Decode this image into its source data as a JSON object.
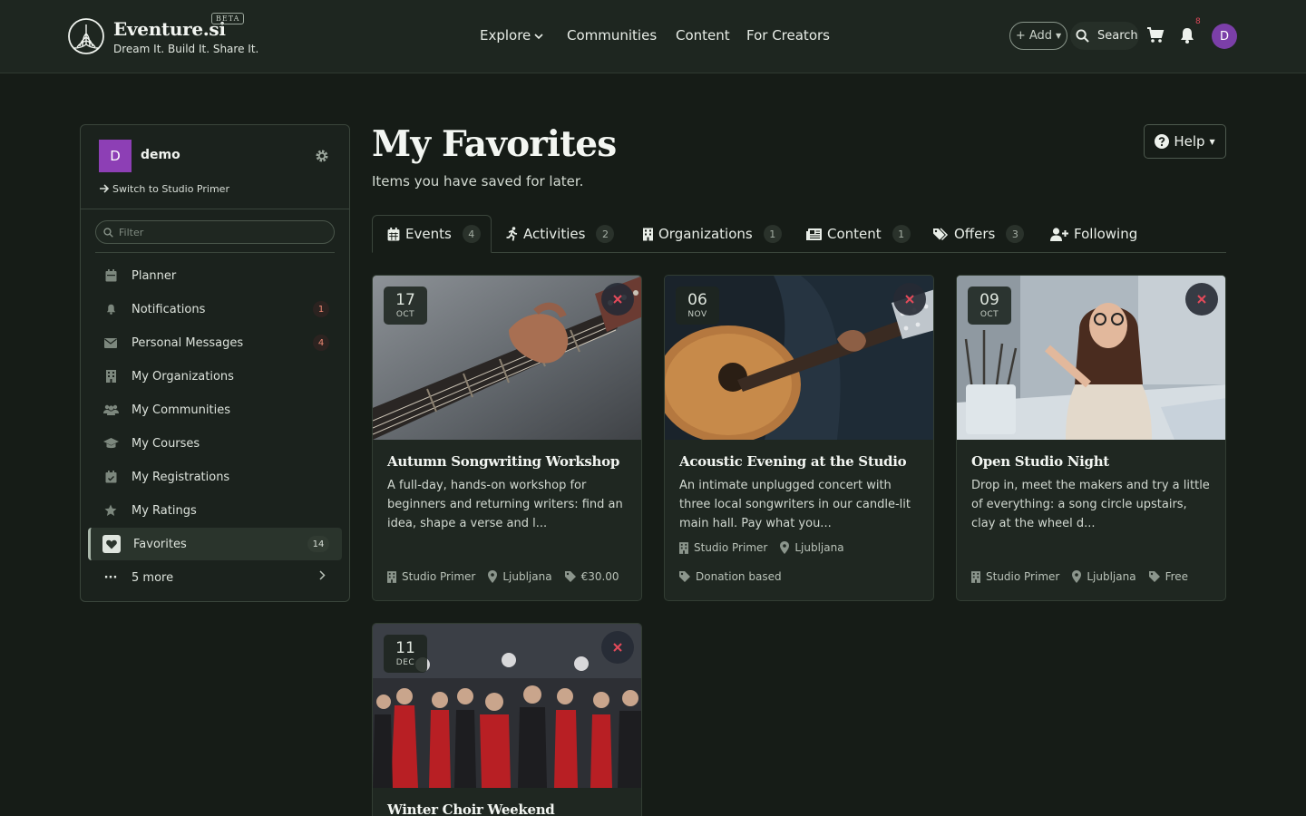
{
  "header": {
    "brand": "Eventure.si",
    "beta": "BETA",
    "tagline": "Dream It. Build It. Share It.",
    "nav": [
      "Explore",
      "Communities",
      "Content",
      "For Creators"
    ],
    "add_label": "+ Add",
    "search_label": "Search",
    "notification_count": "8",
    "avatar_initial": "D"
  },
  "sidebar": {
    "avatar_initial": "D",
    "username": "demo",
    "switch_label": "Switch to Studio Primer",
    "filter_placeholder": "Filter",
    "items": [
      {
        "label": "Planner",
        "icon": "calendar-icon",
        "badge": ""
      },
      {
        "label": "Notifications",
        "icon": "bell-icon",
        "badge": "1"
      },
      {
        "label": "Personal Messages",
        "icon": "envelope-icon",
        "badge": "4"
      },
      {
        "label": "My Organizations",
        "icon": "building-icon",
        "badge": ""
      },
      {
        "label": "My Communities",
        "icon": "users-icon",
        "badge": ""
      },
      {
        "label": "My Courses",
        "icon": "graduation-cap-icon",
        "badge": ""
      },
      {
        "label": "My Registrations",
        "icon": "calendar-check-icon",
        "badge": ""
      },
      {
        "label": "My Ratings",
        "icon": "star-icon",
        "badge": ""
      },
      {
        "label": "Favorites",
        "icon": "heart-icon",
        "badge": "14",
        "active": true
      },
      {
        "label": "5 more",
        "icon": "ellipsis-icon",
        "badge": ""
      }
    ]
  },
  "page": {
    "title": "My Favorites",
    "subtitle": "Items you have saved for later.",
    "help_label": "Help"
  },
  "tabs": [
    {
      "label": "Events",
      "count": "4",
      "icon": "calendar-icon"
    },
    {
      "label": "Activities",
      "count": "2",
      "icon": "running-icon"
    },
    {
      "label": "Organizations",
      "count": "1",
      "icon": "building-icon"
    },
    {
      "label": "Content",
      "count": "1",
      "icon": "newspaper-icon"
    },
    {
      "label": "Offers",
      "count": "3",
      "icon": "tags-icon"
    },
    {
      "label": "Following",
      "count": "",
      "icon": "user-plus-icon"
    }
  ],
  "cards": [
    {
      "day": "17",
      "month": "OCT",
      "title": "Autumn Songwriting Workshop",
      "description": "A full-day, hands-on workshop for beginners and returning writers: find an idea, shape a verse and l...",
      "organizer": "Studio Primer",
      "location": "Ljubljana",
      "price": "€30.00"
    },
    {
      "day": "06",
      "month": "NOV",
      "title": "Acoustic Evening at the Studio",
      "description": "An intimate unplugged concert with three local songwriters in our candle-lit main hall. Pay what you...",
      "organizer": "Studio Primer",
      "location": "Ljubljana",
      "price": "Donation based"
    },
    {
      "day": "09",
      "month": "OCT",
      "title": "Open Studio Night",
      "description": "Drop in, meet the makers and try a little of everything: a song circle upstairs, clay at the wheel d...",
      "organizer": "Studio Primer",
      "location": "Ljubljana",
      "price": "Free"
    },
    {
      "day": "11",
      "month": "DEC",
      "title": "Winter Choir Weekend",
      "description": "",
      "organizer": "",
      "location": "",
      "price": ""
    }
  ],
  "colors": {
    "background": "#161c17",
    "header": "#1e2620",
    "accent_purple": "#8d3fb5",
    "remove_red": "#e44a5a"
  }
}
